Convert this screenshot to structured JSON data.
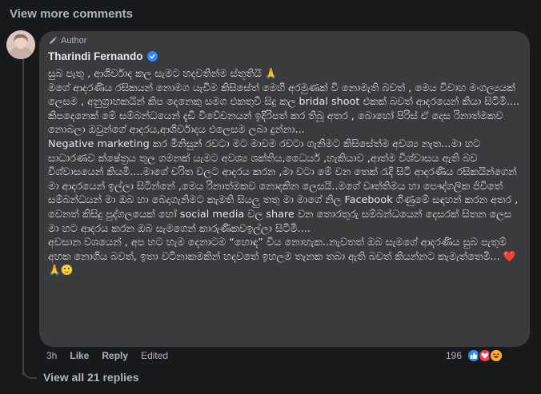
{
  "view_more_comments": "View more comments",
  "comment": {
    "author_badge": "Author",
    "author_name": "Tharindi Fernando",
    "paragraphs": [
      "සුබ පැතූ , ආශිර්වාද කල සැමට හදවතින්ම ස්තූතියි 🙏",
      "මගේ ආදරණිය රසිකයන් නොමග යැවීම කිසිසේත් මෙහි අරමුණක් වි නොමැති බවත් , මෙය විවාහ මංගල්‍යයක් ලෙසම , අනුග්‍රාහකයින් කිප දෙනෙකු සමග එකතුවී සිදු කල bridal shoot එකක් බවත් ආදරයෙන් කියා සිටිමි....",
      "කිපදෙනෙක් මේ සම්බන්ධයෙන් දැඩි විවේචනයන් ඉදිරිපත් කර තිබූ අතර , බොහෝ පිරිස් ඒ දෙස රිනාත්මකව නොබලා ඔවුන්ගේ ආදරය,ආශිර්වාදය එලෙසම ලබා දුන්නා...",
      "Negative marketing කර මිනිසුන් රවටා මට මාවම රවටා ගැනිමට කිසිසේත්ම අවශ්‍ය නැත...මා හට සාධාරණව ක්ෂේත්‍රය තුල ගමනක් යැමට අවශ්‍ය ශක්තිය,ධෛර්ය ,හැකියාව ,ආත්ම විශ්වාසය ඇති බව විශ්වාසයෙන් කියමි....මාගේ චරිත වලට ආදරය කරන ,මා වටා මේ වන තෙක් රැදි සිටි ආදරණිය රසිකයින්ගෙන් මා ආදරයෙන් ඉල්ලා සිටින්නේ ,මෙය රිනාත්මකව නොදකින ලෙසයි..මගේ වෘත්තිමය හා පෞද්ගලික ජිවිතේ සම්බන්ධයන් මා ඔබ හා බෙදාගැනිමට කැමති සියලු තතු මා මාගේ නිල Facebook ගිණුමේ සඳහන් කරන අතර , වෙනත් කිසිදු පුද්ගලයෙක් හෝ social media වල share වන තොරතුරු සම්බන්ධයෙන් දෙසරක් සිතන ලෙස මා හට ආදරය කරන ඔබ සැමගෙන් කාරුණිකවඉල්ලා සිටිමි....",
      "අවසාන වශයෙන් , අප හට හැම දෙනාටම “හොඳ” විය නොහැක..නැවතත් ඔබ සැමගේ ආදරණිය සුබ පැතුම් අහක නොගිය බවත්, ඉතා වටිනාකමකින් හදවතේ ඉහලම තැනක තබා ඇති බවත් කියන්නට කැමැත්තෙමි... ❤️🙏🙂"
    ],
    "time": "3h",
    "like_label": "Like",
    "reply_label": "Reply",
    "edited_label": "Edited",
    "reaction_count": "196",
    "reaction_icons": [
      "like-icon",
      "love-icon",
      "haha-icon"
    ]
  },
  "view_replies": "View all 21 replies",
  "colors": {
    "background": "#18191a",
    "bubble": "#3a3b3c",
    "text": "#e4e6eb",
    "muted": "#b0b3b8",
    "verified": "#2d88ff",
    "like": "#2d88ff",
    "love": "#f33e58",
    "haha": "#f7b125"
  }
}
